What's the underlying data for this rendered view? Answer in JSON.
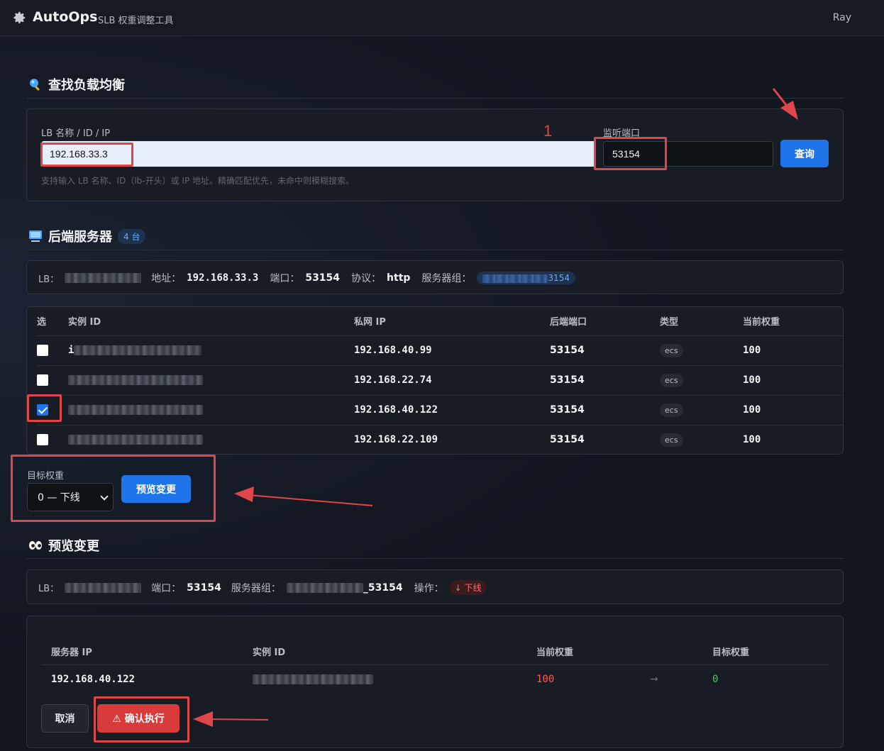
{
  "header": {
    "brand": "AutoOps",
    "subtitle": "SLB 权重调整工具",
    "user": "Ray"
  },
  "search": {
    "title": "查找负载均衡",
    "lb_label": "LB 名称 / ID / IP",
    "lb_value": "192.168.33.3",
    "port_label": "监听端口",
    "port_value": "53154",
    "query_button": "查询",
    "help": "支持输入 LB 名称、ID（lb-开头）或 IP 地址。精确匹配优先，未命中则模糊搜索。",
    "annotation_number": "1"
  },
  "backend": {
    "title": "后端服务器",
    "count_badge": "4 台",
    "info": {
      "lb_label": "LB：",
      "address_label": "地址：",
      "address": "192.168.33.3",
      "port_label": "端口：",
      "port": "53154",
      "protocol_label": "协议：",
      "protocol": "http",
      "group_label": "服务器组：",
      "group_suffix": "3154"
    },
    "columns": [
      "选",
      "实例 ID",
      "私网 IP",
      "后端端口",
      "类型",
      "当前权重"
    ],
    "rows": [
      {
        "instance_prefix": "i",
        "ip": "192.168.40.99",
        "port": "53154",
        "type": "ecs",
        "weight": "100",
        "checked": false
      },
      {
        "instance_prefix": "",
        "ip": "192.168.22.74",
        "port": "53154",
        "type": "ecs",
        "weight": "100",
        "checked": false
      },
      {
        "instance_prefix": "",
        "ip": "192.168.40.122",
        "port": "53154",
        "type": "ecs",
        "weight": "100",
        "checked": true
      },
      {
        "instance_prefix": "",
        "ip": "192.168.22.109",
        "port": "53154",
        "type": "ecs",
        "weight": "100",
        "checked": false
      }
    ]
  },
  "target": {
    "label": "目标权重",
    "select_value": "0 — 下线",
    "preview_button": "预览变更"
  },
  "preview": {
    "title": "预览变更",
    "info": {
      "lb_label": "LB：",
      "port_label": "端口：",
      "port": "53154",
      "group_label": "服务器组：",
      "group_suffix": "_53154",
      "op_label": "操作：",
      "op_value": "↓ 下线"
    },
    "columns": [
      "服务器 IP",
      "实例 ID",
      "当前权重",
      "目标权重"
    ],
    "row": {
      "ip": "192.168.40.122",
      "current": "100",
      "arrow": "→",
      "target": "0"
    },
    "cancel_button": "取消",
    "confirm_button": "⚠ 确认执行"
  },
  "colors": {
    "accent": "#1e74e8",
    "danger": "#d93a3a",
    "annotation": "#e0454a",
    "weight_current": "#ff5a5a",
    "weight_target": "#4cc46a"
  }
}
